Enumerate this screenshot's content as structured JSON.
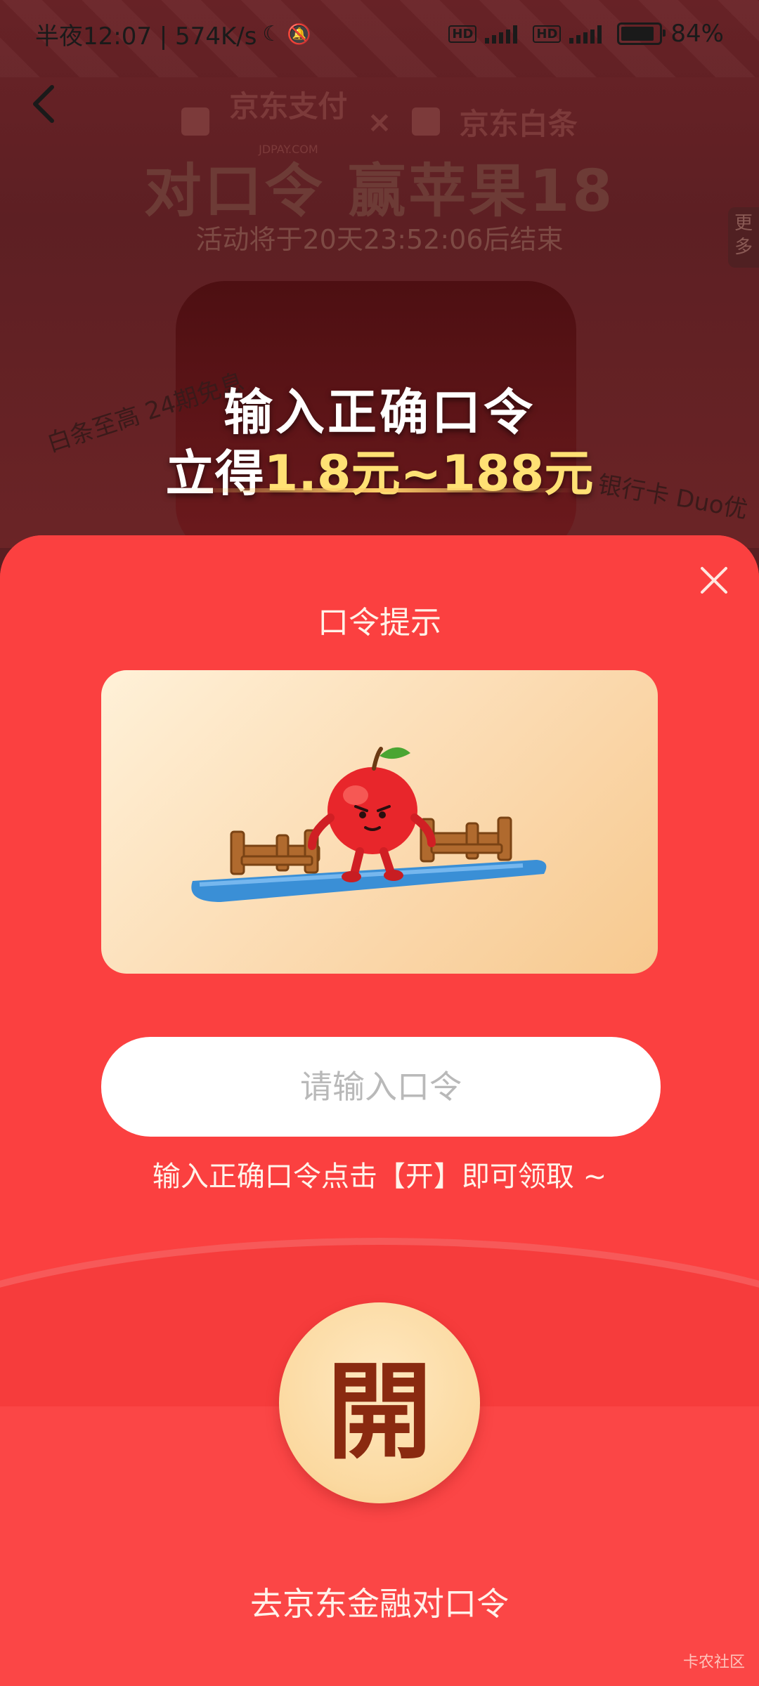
{
  "status_bar": {
    "time_speed": "半夜12:07 | 574K/s",
    "battery": "84%"
  },
  "header": {
    "logo_pay": "京东支付",
    "logo_pay_sub": "JDPAY.COM",
    "logo_separator": "×",
    "logo_baitiao": "京东白条",
    "title": "对口令 赢苹果18",
    "countdown": "活动将于20天23:52:06后结束",
    "more": "更多"
  },
  "promo": {
    "line1": "输入正确口令",
    "line2_prefix": "立得",
    "line2_amount": "1.8元~188元"
  },
  "background_deco": {
    "left_note": "白条至高 24期免息",
    "right_note": "银行卡 Duo优"
  },
  "modal": {
    "title": "口令提示",
    "input_placeholder": "请输入口令",
    "tip": "输入正确口令点击【开】即可领取 ~",
    "open_button": "開",
    "go_link": "去京东金融对口令"
  },
  "watermark": "卡农社区",
  "colors": {
    "modal_red": "#fb4646",
    "button_cream": "#fbd9a0",
    "button_glyph": "#8a2a10",
    "promo_amount": "#ffe174"
  }
}
